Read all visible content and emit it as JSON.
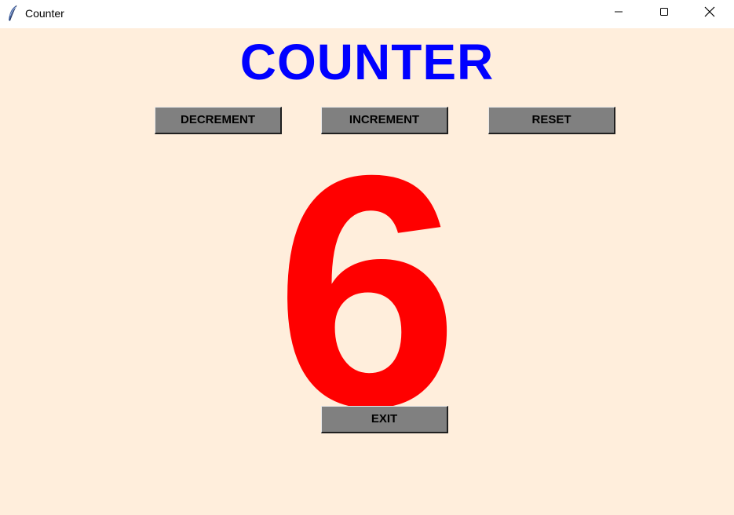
{
  "window": {
    "title": "Counter",
    "controls": {
      "minimize": "minimize-icon",
      "maximize": "maximize-icon",
      "close": "close-icon"
    },
    "app_icon": "feather-icon"
  },
  "app": {
    "heading": "COUNTER",
    "count": "6",
    "buttons": {
      "decrement": "DECREMENT",
      "increment": "INCREMENT",
      "reset": "RESET",
      "exit": "EXIT"
    }
  },
  "colors": {
    "background": "#ffeedc",
    "heading": "#0000ff",
    "count": "#ff0000",
    "button": "#808080"
  }
}
